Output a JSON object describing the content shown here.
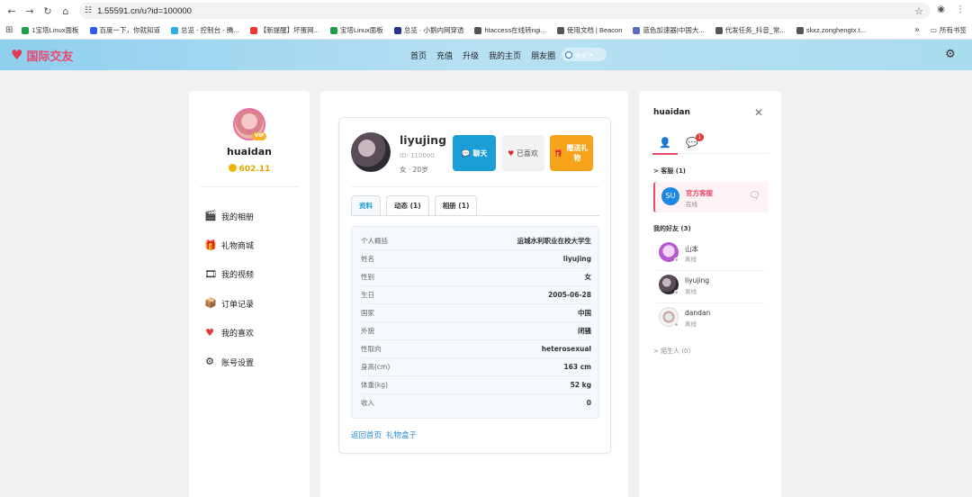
{
  "browser": {
    "url": "1.55591.cn/u?id=100000",
    "bookmarks": [
      "1宝塔Linux面板",
      "百度一下，你就知道",
      "总览 - 控制台 - 腾...",
      "【新提醒】坏蛋网...",
      "宝塔Linux面板",
      "总览 · 小鹅内网穿透",
      "htaccess在线转ngi...",
      "使用文档 | Beacon",
      "蓝色加速器|中国大...",
      "代发任务_抖音_常...",
      "skxz.zonghengtx.t..."
    ],
    "all_bookmarks": "所有书签"
  },
  "header": {
    "brand": "国际交友",
    "nav": [
      "首页",
      "充值",
      "升级",
      "我的主页",
      "朋友圈"
    ],
    "language": "中文"
  },
  "left": {
    "vip": "VIP",
    "username": "huaidan",
    "coins": "602.11",
    "menu": [
      {
        "icon": "photo-album-icon",
        "label": "我的相册"
      },
      {
        "icon": "gift-box-icon",
        "label": "礼物商城"
      },
      {
        "icon": "video-icon",
        "label": "我的视频"
      },
      {
        "icon": "orders-icon",
        "label": "订单记录"
      },
      {
        "icon": "heart-icon",
        "label": "我的喜欢"
      },
      {
        "icon": "settings-icon",
        "label": "账号设置"
      }
    ]
  },
  "profile": {
    "name": "liyujing",
    "id_text": "ID: 110000",
    "gender": "女",
    "age": "20岁",
    "buttons": {
      "chat": "聊天",
      "liked": "已喜欢",
      "gift": "赠送礼物"
    },
    "tabs": [
      "资料",
      "动态 (1)",
      "相册 (1)"
    ],
    "info": [
      {
        "k": "个人概括",
        "v": "运城水利职业在校大学生"
      },
      {
        "k": "姓名",
        "v": "liyujing"
      },
      {
        "k": "性别",
        "v": "女"
      },
      {
        "k": "生日",
        "v": "2005-06-28"
      },
      {
        "k": "国家",
        "v": "中国"
      },
      {
        "k": "外貌",
        "v": "闭骚"
      },
      {
        "k": "性取向",
        "v": "heterosexual"
      },
      {
        "k": "身高(cm)",
        "v": "163 cm"
      },
      {
        "k": "体重(kg)",
        "v": "52 kg"
      },
      {
        "k": "收入",
        "v": "0"
      }
    ],
    "links": [
      "返回首页",
      "礼物盒子"
    ]
  },
  "chat": {
    "user": "huaidan",
    "msg_badge": "1",
    "service_section": "> 客服 (1)",
    "service_avatar": "SU",
    "service_name": "官方客服",
    "service_status": "在线",
    "friends_section": "我的好友 (3)",
    "friends": [
      {
        "name": "山本",
        "status": "离线"
      },
      {
        "name": "liyujing",
        "status": "离线"
      },
      {
        "name": "dandan",
        "status": "离线"
      }
    ],
    "strangers_section": "> 陌生人 (0)"
  }
}
